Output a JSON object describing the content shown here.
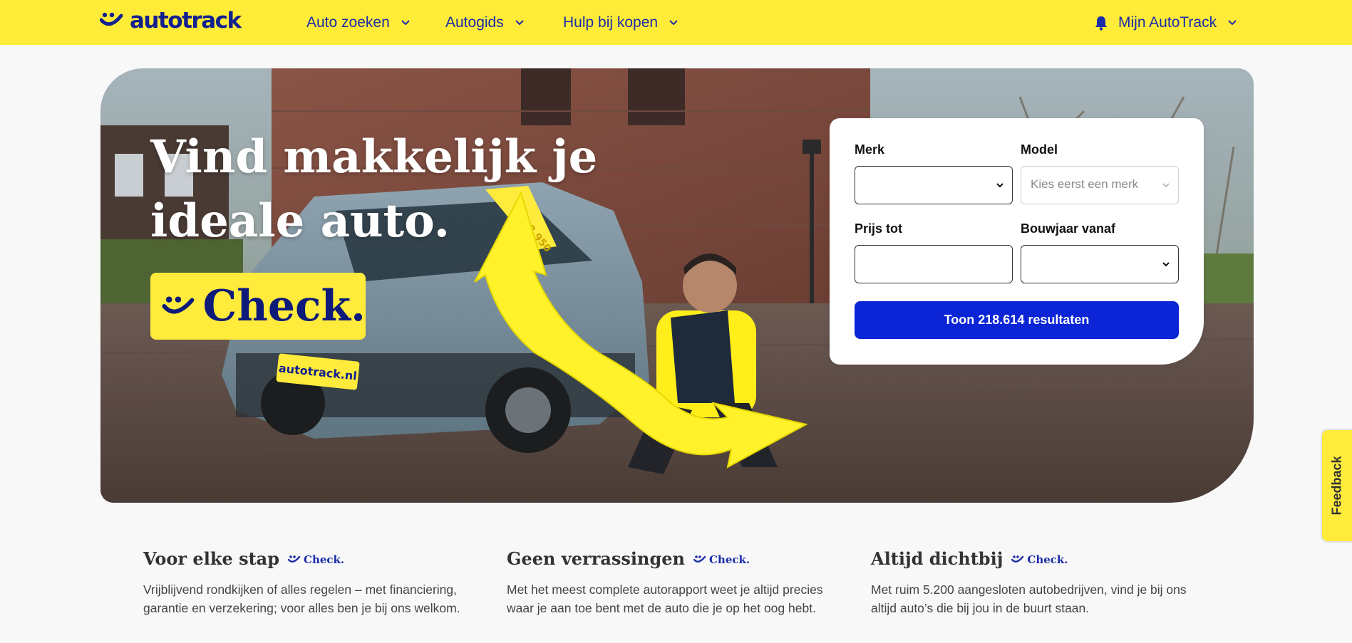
{
  "brand": {
    "logo_text": "autotrack"
  },
  "nav": {
    "items": [
      {
        "label": "Auto zoeken"
      },
      {
        "label": "Autogids"
      },
      {
        "label": "Hulp bij kopen"
      }
    ],
    "account_label": "Mijn AutoTrack"
  },
  "hero": {
    "title_line1": "Vind makkelijk je",
    "title_line2": "ideale auto.",
    "badge_text": "Check.",
    "plate_text": "autotrack.nl",
    "price_sticker": "€18.950"
  },
  "search": {
    "make_label": "Merk",
    "model_label": "Model",
    "model_placeholder": "Kies eerst een merk",
    "price_label": "Prijs tot",
    "year_label": "Bouwjaar vanaf",
    "button_label": "Toon 218.614 resultaten"
  },
  "features": [
    {
      "title": "Voor elke stap",
      "check": "Check.",
      "text": "Vrijblijvend rondkijken of alles regelen – met financiering, garantie en verzekering; voor alles ben je bij ons welkom."
    },
    {
      "title": "Geen verrassingen",
      "check": "Check.",
      "text": "Met het meest complete autorapport weet je altijd precies waar je aan toe bent met de auto die je op het oog hebt."
    },
    {
      "title": "Altijd dichtbij",
      "check": "Check.",
      "text": "Met ruim 5.200 aangesloten autobedrijven, vind je bij ons altijd auto’s die bij jou in de buurt staan."
    }
  ],
  "feedback_label": "Feedback",
  "colors": {
    "brand_yellow": "#ffec38",
    "brand_blue": "#1b2ca8",
    "cta_blue": "#0a24d6"
  }
}
